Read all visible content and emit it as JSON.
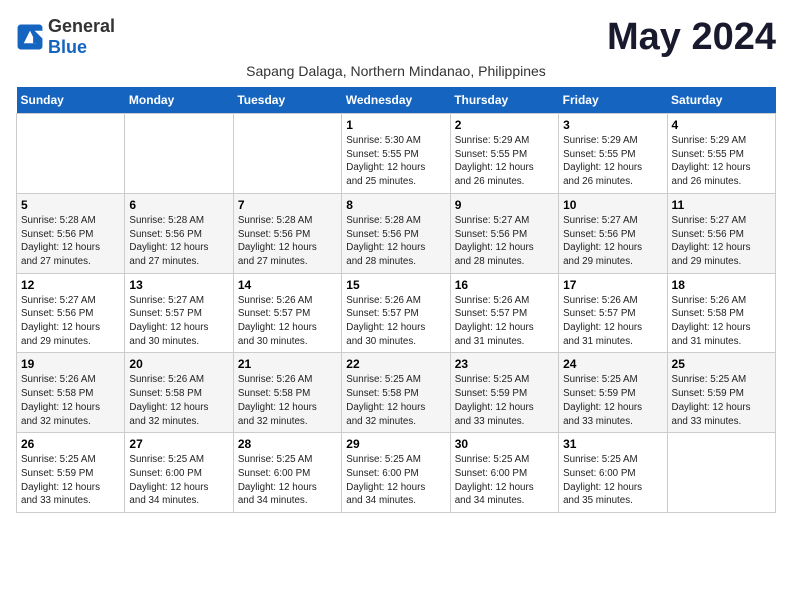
{
  "logo": {
    "general": "General",
    "blue": "Blue"
  },
  "title": "May 2024",
  "subtitle": "Sapang Dalaga, Northern Mindanao, Philippines",
  "headers": [
    "Sunday",
    "Monday",
    "Tuesday",
    "Wednesday",
    "Thursday",
    "Friday",
    "Saturday"
  ],
  "weeks": [
    [
      {
        "day": "",
        "info": ""
      },
      {
        "day": "",
        "info": ""
      },
      {
        "day": "",
        "info": ""
      },
      {
        "day": "1",
        "info": "Sunrise: 5:30 AM\nSunset: 5:55 PM\nDaylight: 12 hours\nand 25 minutes."
      },
      {
        "day": "2",
        "info": "Sunrise: 5:29 AM\nSunset: 5:55 PM\nDaylight: 12 hours\nand 26 minutes."
      },
      {
        "day": "3",
        "info": "Sunrise: 5:29 AM\nSunset: 5:55 PM\nDaylight: 12 hours\nand 26 minutes."
      },
      {
        "day": "4",
        "info": "Sunrise: 5:29 AM\nSunset: 5:55 PM\nDaylight: 12 hours\nand 26 minutes."
      }
    ],
    [
      {
        "day": "5",
        "info": "Sunrise: 5:28 AM\nSunset: 5:56 PM\nDaylight: 12 hours\nand 27 minutes."
      },
      {
        "day": "6",
        "info": "Sunrise: 5:28 AM\nSunset: 5:56 PM\nDaylight: 12 hours\nand 27 minutes."
      },
      {
        "day": "7",
        "info": "Sunrise: 5:28 AM\nSunset: 5:56 PM\nDaylight: 12 hours\nand 27 minutes."
      },
      {
        "day": "8",
        "info": "Sunrise: 5:28 AM\nSunset: 5:56 PM\nDaylight: 12 hours\nand 28 minutes."
      },
      {
        "day": "9",
        "info": "Sunrise: 5:27 AM\nSunset: 5:56 PM\nDaylight: 12 hours\nand 28 minutes."
      },
      {
        "day": "10",
        "info": "Sunrise: 5:27 AM\nSunset: 5:56 PM\nDaylight: 12 hours\nand 29 minutes."
      },
      {
        "day": "11",
        "info": "Sunrise: 5:27 AM\nSunset: 5:56 PM\nDaylight: 12 hours\nand 29 minutes."
      }
    ],
    [
      {
        "day": "12",
        "info": "Sunrise: 5:27 AM\nSunset: 5:56 PM\nDaylight: 12 hours\nand 29 minutes."
      },
      {
        "day": "13",
        "info": "Sunrise: 5:27 AM\nSunset: 5:57 PM\nDaylight: 12 hours\nand 30 minutes."
      },
      {
        "day": "14",
        "info": "Sunrise: 5:26 AM\nSunset: 5:57 PM\nDaylight: 12 hours\nand 30 minutes."
      },
      {
        "day": "15",
        "info": "Sunrise: 5:26 AM\nSunset: 5:57 PM\nDaylight: 12 hours\nand 30 minutes."
      },
      {
        "day": "16",
        "info": "Sunrise: 5:26 AM\nSunset: 5:57 PM\nDaylight: 12 hours\nand 31 minutes."
      },
      {
        "day": "17",
        "info": "Sunrise: 5:26 AM\nSunset: 5:57 PM\nDaylight: 12 hours\nand 31 minutes."
      },
      {
        "day": "18",
        "info": "Sunrise: 5:26 AM\nSunset: 5:58 PM\nDaylight: 12 hours\nand 31 minutes."
      }
    ],
    [
      {
        "day": "19",
        "info": "Sunrise: 5:26 AM\nSunset: 5:58 PM\nDaylight: 12 hours\nand 32 minutes."
      },
      {
        "day": "20",
        "info": "Sunrise: 5:26 AM\nSunset: 5:58 PM\nDaylight: 12 hours\nand 32 minutes."
      },
      {
        "day": "21",
        "info": "Sunrise: 5:26 AM\nSunset: 5:58 PM\nDaylight: 12 hours\nand 32 minutes."
      },
      {
        "day": "22",
        "info": "Sunrise: 5:25 AM\nSunset: 5:58 PM\nDaylight: 12 hours\nand 32 minutes."
      },
      {
        "day": "23",
        "info": "Sunrise: 5:25 AM\nSunset: 5:59 PM\nDaylight: 12 hours\nand 33 minutes."
      },
      {
        "day": "24",
        "info": "Sunrise: 5:25 AM\nSunset: 5:59 PM\nDaylight: 12 hours\nand 33 minutes."
      },
      {
        "day": "25",
        "info": "Sunrise: 5:25 AM\nSunset: 5:59 PM\nDaylight: 12 hours\nand 33 minutes."
      }
    ],
    [
      {
        "day": "26",
        "info": "Sunrise: 5:25 AM\nSunset: 5:59 PM\nDaylight: 12 hours\nand 33 minutes."
      },
      {
        "day": "27",
        "info": "Sunrise: 5:25 AM\nSunset: 6:00 PM\nDaylight: 12 hours\nand 34 minutes."
      },
      {
        "day": "28",
        "info": "Sunrise: 5:25 AM\nSunset: 6:00 PM\nDaylight: 12 hours\nand 34 minutes."
      },
      {
        "day": "29",
        "info": "Sunrise: 5:25 AM\nSunset: 6:00 PM\nDaylight: 12 hours\nand 34 minutes."
      },
      {
        "day": "30",
        "info": "Sunrise: 5:25 AM\nSunset: 6:00 PM\nDaylight: 12 hours\nand 34 minutes."
      },
      {
        "day": "31",
        "info": "Sunrise: 5:25 AM\nSunset: 6:00 PM\nDaylight: 12 hours\nand 35 minutes."
      },
      {
        "day": "",
        "info": ""
      }
    ]
  ]
}
